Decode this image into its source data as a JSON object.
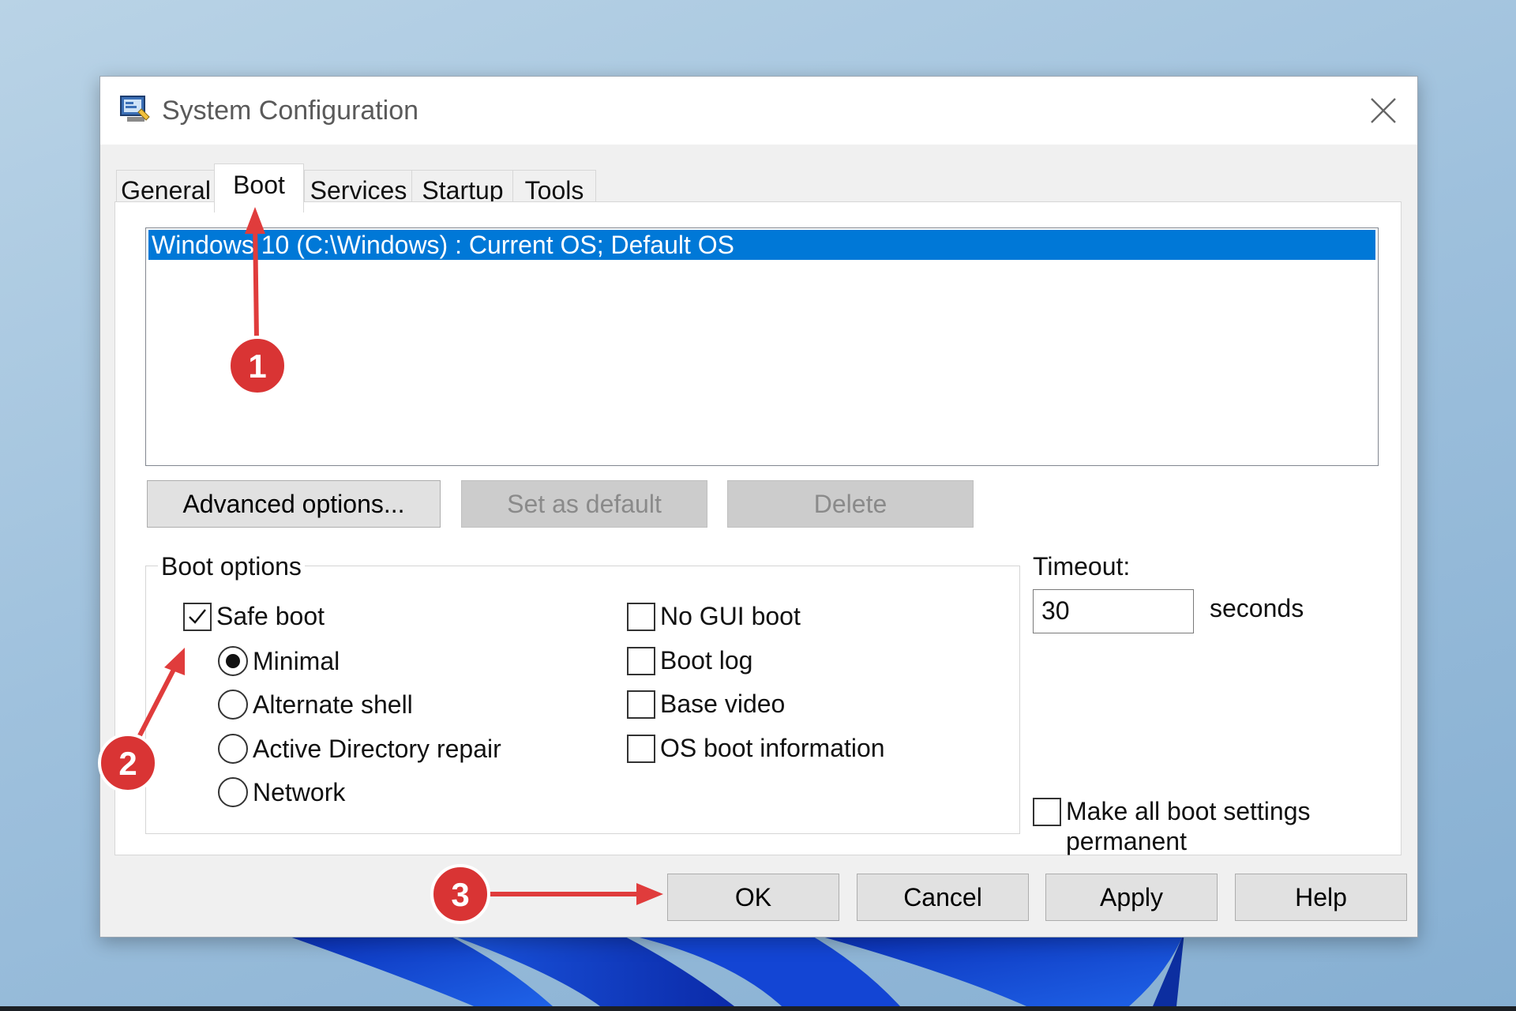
{
  "window": {
    "title": "System Configuration",
    "close_icon": "close-icon"
  },
  "tabs": [
    {
      "label": "General",
      "active": false
    },
    {
      "label": "Boot",
      "active": true
    },
    {
      "label": "Services",
      "active": false
    },
    {
      "label": "Startup",
      "active": false
    },
    {
      "label": "Tools",
      "active": false
    }
  ],
  "boot": {
    "os_list": [
      "Windows 10 (C:\\Windows) : Current OS; Default OS"
    ],
    "buttons": {
      "advanced": "Advanced options...",
      "set_default": "Set as default",
      "delete": "Delete"
    },
    "options_group_label": "Boot options",
    "safe_boot": {
      "label": "Safe boot",
      "checked": true
    },
    "safe_boot_modes": [
      {
        "label": "Minimal",
        "selected": true
      },
      {
        "label": "Alternate shell",
        "selected": false
      },
      {
        "label": "Active Directory repair",
        "selected": false
      },
      {
        "label": "Network",
        "selected": false
      }
    ],
    "flags": [
      {
        "label": "No GUI boot",
        "checked": false
      },
      {
        "label": "Boot log",
        "checked": false
      },
      {
        "label": "Base video",
        "checked": false
      },
      {
        "label": "OS boot information",
        "checked": false
      }
    ],
    "timeout": {
      "label": "Timeout:",
      "value": "30",
      "unit": "seconds"
    },
    "permanent": {
      "label_line1": "Make all boot settings",
      "label_line2": "permanent",
      "checked": false
    }
  },
  "footer": {
    "ok": "OK",
    "cancel": "Cancel",
    "apply": "Apply",
    "help": "Help"
  },
  "annotations": [
    "1",
    "2",
    "3"
  ],
  "colors": {
    "selection": "#0078d7",
    "annotation_red": "#e03c3c",
    "button_face": "#e1e1e1"
  }
}
